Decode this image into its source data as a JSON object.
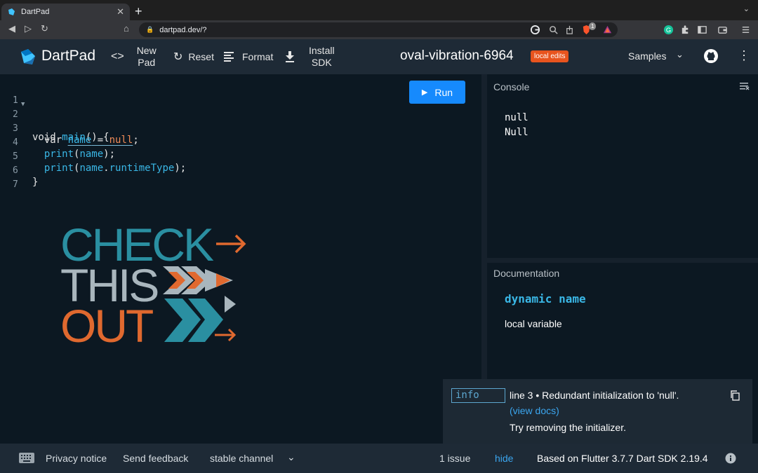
{
  "browser": {
    "tab_title": "DartPad",
    "tab_close": "✕",
    "new_tab": "+",
    "tab_menu": "⌄",
    "url": "dartpad.dev/?",
    "nav": {
      "back": "◀",
      "forward": "▷",
      "reload": "↻",
      "bookmark": "⌂"
    },
    "extensions_badge": "1"
  },
  "header": {
    "brand": "DartPad",
    "new_pad": [
      "New",
      "Pad"
    ],
    "reset": "Reset",
    "format": "Format",
    "install_sdk": [
      "Install",
      "SDK"
    ],
    "pad_name": "oval-vibration-6964",
    "local_edits": "local edits",
    "samples": "Samples"
  },
  "editor": {
    "run_label": "Run",
    "lines": [
      {
        "num": "1",
        "code": ""
      },
      {
        "num": "2",
        "code": "void main() {"
      },
      {
        "num": "3",
        "code": "  var name = null;"
      },
      {
        "num": "4",
        "code": "  print(name);"
      },
      {
        "num": "5",
        "code": "  print(name.runtimeType);"
      },
      {
        "num": "6",
        "code": "}"
      },
      {
        "num": "7",
        "code": ""
      }
    ],
    "overlay": {
      "line1": "CHECK",
      "line2": "THIS",
      "line3": "OUT"
    }
  },
  "console": {
    "title": "Console",
    "output": [
      "null",
      "Null"
    ]
  },
  "docs": {
    "title": "Documentation",
    "signature": "dynamic name",
    "kind": "local variable"
  },
  "issue": {
    "severity": "info",
    "message": "line 3 • Redundant initialization to 'null'.",
    "link": "(view docs)",
    "fix": "Try removing the initializer."
  },
  "footer": {
    "privacy": "Privacy notice",
    "feedback": "Send feedback",
    "channel": "stable channel",
    "issues": "1 issue",
    "hide": "hide",
    "version": "Based on Flutter 3.7.7 Dart SDK 2.19.4"
  },
  "colors": {
    "accent": "#168afd",
    "badge": "#e8541e",
    "overlay_teal": "#2a8fa1",
    "overlay_orange": "#e0692f",
    "overlay_gray": "#a9b6bd"
  }
}
